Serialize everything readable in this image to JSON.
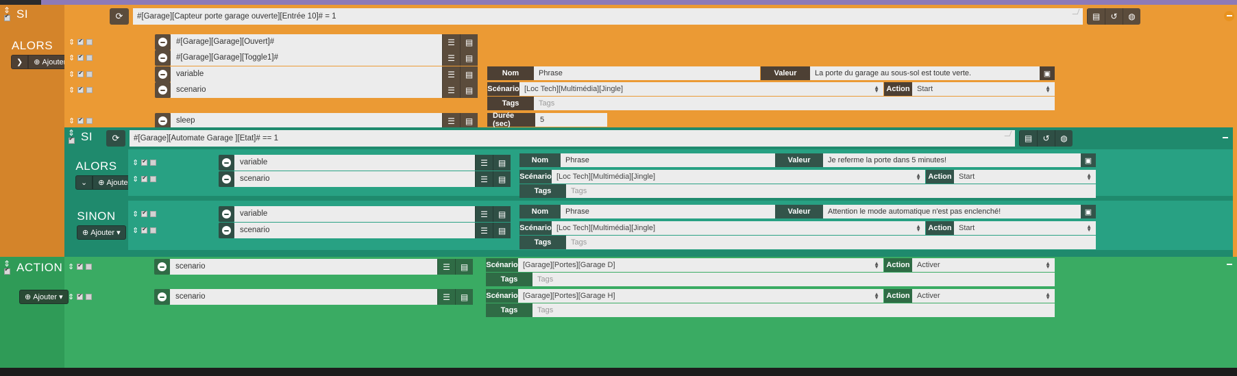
{
  "colors": {
    "orange": "#eb9a34",
    "orange_dark": "#d4842a",
    "teal": "#1f8a6d",
    "teal_light": "#28a183",
    "green": "#3aab63",
    "dark_brown": "#4d4034",
    "purple_strip": "#8d7ab8"
  },
  "if_block": {
    "label_si": "SI",
    "label_alors": "ALORS",
    "add_button": "Ajouter",
    "expression": "#[Garage][Capteur porte garage ouverte][Entrée 10]# = 1",
    "refresh_icon": "refresh-icon",
    "header_icons": [
      "list-icon",
      "history-icon",
      "box-icon"
    ],
    "actions": [
      {
        "name": "#[Garage][Garage][Ouvert]#",
        "icons": [
          "list-icon",
          "grid-icon"
        ]
      },
      {
        "name": "#[Garage][Garage][Toggle1]#",
        "icons": [
          "list-icon",
          "grid-icon"
        ]
      },
      {
        "name": "variable",
        "icons": [
          "list-icon",
          "grid-icon"
        ],
        "fields": [
          {
            "label": "Nom",
            "value": "Phrase",
            "type": "text"
          },
          {
            "label": "Valeur",
            "value": "La porte du garage au sous-sol est toute verte.",
            "type": "text",
            "end_icon": "keyboard-icon"
          }
        ]
      },
      {
        "name": "scenario",
        "icons": [
          "list-icon",
          "grid-icon"
        ],
        "fields": [
          {
            "label": "Scénario",
            "value": "[Loc Tech][Multimédia][Jingle]",
            "type": "select"
          },
          {
            "label": "Action",
            "value": "Start",
            "type": "select"
          },
          {
            "label": "Tags",
            "value": "Tags",
            "type": "placeholder"
          }
        ]
      },
      {
        "name": "sleep",
        "icons": [
          "list-icon",
          "grid-icon"
        ],
        "fields": [
          {
            "label": "Durée (sec)",
            "value": "5",
            "type": "text"
          }
        ]
      }
    ]
  },
  "nested_if_block": {
    "label_si": "SI",
    "label_alors": "ALORS",
    "label_sinon": "SINON",
    "add_button": "Ajouter",
    "expression": "#[Garage][Automate Garage ][Etat]# == 1",
    "refresh_icon": "refresh-icon",
    "header_icons": [
      "list-icon",
      "history-icon",
      "box-icon"
    ],
    "then_actions": [
      {
        "name": "variable",
        "icons": [
          "list-icon",
          "grid-icon"
        ],
        "fields": [
          {
            "label": "Nom",
            "value": "Phrase",
            "type": "text"
          },
          {
            "label": "Valeur",
            "value": "Je referme la porte dans 5 minutes!",
            "type": "text",
            "end_icon": "keyboard-icon"
          }
        ]
      },
      {
        "name": "scenario",
        "icons": [
          "list-icon",
          "grid-icon"
        ],
        "fields": [
          {
            "label": "Scénario",
            "value": "[Loc Tech][Multimédia][Jingle]",
            "type": "select"
          },
          {
            "label": "Action",
            "value": "Start",
            "type": "select"
          },
          {
            "label": "Tags",
            "value": "Tags",
            "type": "placeholder"
          }
        ]
      }
    ],
    "else_actions": [
      {
        "name": "variable",
        "icons": [
          "list-icon",
          "grid-icon"
        ],
        "fields": [
          {
            "label": "Nom",
            "value": "Phrase",
            "type": "text"
          },
          {
            "label": "Valeur",
            "value": "Attention le mode automatique n'est pas enclenché!",
            "type": "text",
            "end_icon": "keyboard-icon"
          }
        ]
      },
      {
        "name": "scenario",
        "icons": [
          "list-icon",
          "grid-icon"
        ],
        "fields": [
          {
            "label": "Scénario",
            "value": "[Loc Tech][Multimédia][Jingle]",
            "type": "select"
          },
          {
            "label": "Action",
            "value": "Start",
            "type": "select"
          },
          {
            "label": "Tags",
            "value": "Tags",
            "type": "placeholder"
          }
        ]
      }
    ]
  },
  "action_block": {
    "label_action": "ACTION",
    "add_button": "Ajouter",
    "actions": [
      {
        "name": "scenario",
        "icons": [
          "list-icon",
          "grid-icon"
        ],
        "fields": [
          {
            "label": "Scénario",
            "value": "[Garage][Portes][Garage D]",
            "type": "select"
          },
          {
            "label": "Action",
            "value": "Activer",
            "type": "select"
          },
          {
            "label": "Tags",
            "value": "Tags",
            "type": "placeholder"
          }
        ]
      },
      {
        "name": "scenario",
        "icons": [
          "list-icon",
          "grid-icon"
        ],
        "fields": [
          {
            "label": "Scénario",
            "value": "[Garage][Portes][Garage H]",
            "type": "select"
          },
          {
            "label": "Action",
            "value": "Activer",
            "type": "select"
          },
          {
            "label": "Tags",
            "value": "Tags",
            "type": "placeholder"
          }
        ]
      }
    ]
  }
}
